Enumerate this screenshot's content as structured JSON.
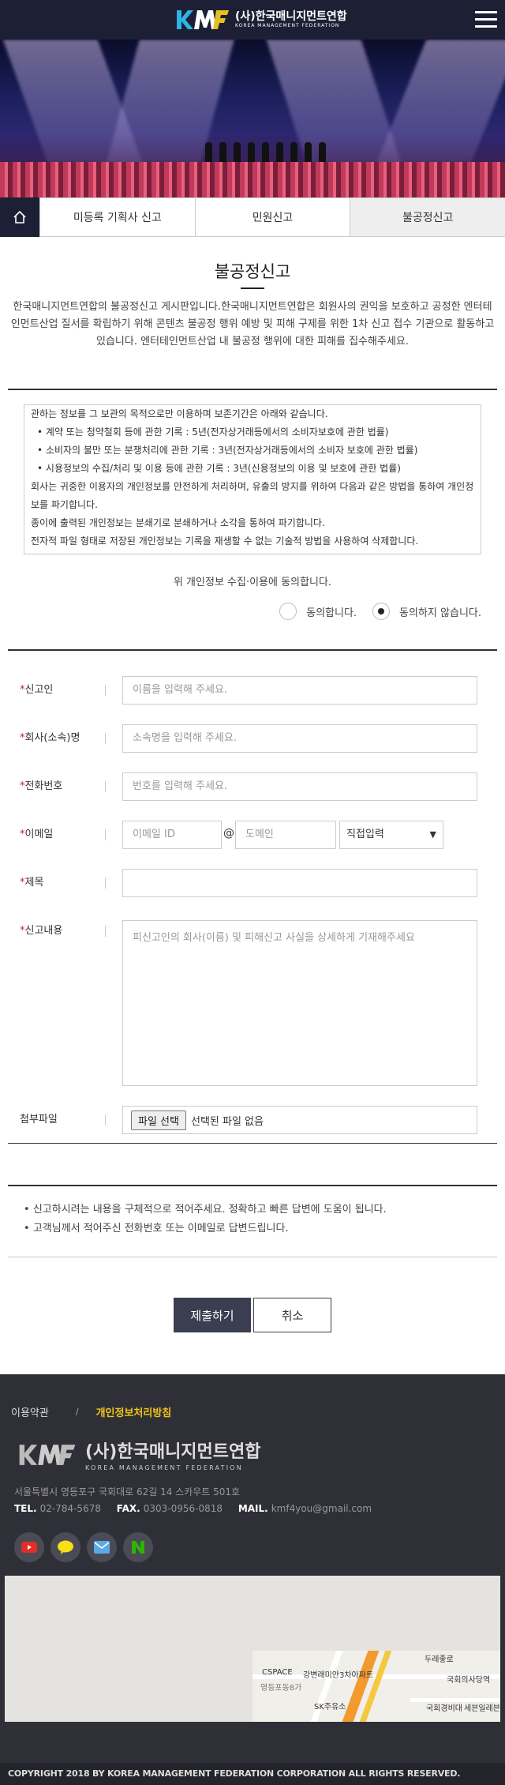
{
  "header": {
    "logo_ko": "(사)한국매니지먼트연합",
    "logo_en": "KOREA MANAGEMENT FEDERATION",
    "logo_mark": "KMF"
  },
  "tabs": [
    {
      "label": "미등록 기획사 신고",
      "active": false
    },
    {
      "label": "민원신고",
      "active": false
    },
    {
      "label": "불공정신고",
      "active": true
    }
  ],
  "page": {
    "title": "불공정신고",
    "intro": "한국매니지먼트연합의 불공정신고 게시판입니다.한국매니지먼트연합은 회원사의 권익을 보호하고 공정한 엔터테인먼트산업 질서를 확립하기 위해 콘텐츠 불공정 행위 예방 및 피해 구제를 위한 1차 신고 접수 기관으로 활동하고 있습니다. 엔터테인먼트산업 내 불공정 행위에 대한 피해를 집수해주세요."
  },
  "privacy": {
    "lines": [
      "관하는 정보를 그 보관의 목적으로만 이용하며 보존기간은 아래와 같습니다.",
      "계약 또는 청약철회 등에 관한 기록 : 5년(전자상거래등에서의 소비자보호에 관한 법률)",
      "소비자의 불만 또는 분쟁처리에 관한 기록 : 3년(전자상거래등에서의 소비자 보호에 관한 법률)",
      "시용정보의 수집/처리 및 이용 등에 관한 기록 : 3년(신용정보의 이용 및 보호에 관한 법률)",
      "회사는 귀중한 이용자의 개인정보를 안전하게 처리하며, 유출의 방지를 위하여 다음과 같은 방법을 통하여 개인정보를 파기합니다.",
      "종이에 출력된 개인정보는 분쇄기로 분쇄하거나 소각을 통하여 파기합니다.",
      "전자적 파일 형태로 저장된 개인정보는 기록을 재생할 수 없는 기술적 방법을 사용하여 삭제합니다."
    ],
    "agree_question": "위 개인정보 수집·이용에 동의합니다.",
    "agree_label": "동의합니다.",
    "disagree_label": "동의하지 않습니다.",
    "selected": "disagree"
  },
  "form": {
    "reporter": {
      "label": "신고인",
      "placeholder": "이름을 입력해 주세요."
    },
    "company": {
      "label": "회사(소속)명",
      "placeholder": "소속명을 입력해 주세요."
    },
    "phone": {
      "label": "전화번호",
      "placeholder": "번호를 입력해 주세요."
    },
    "email": {
      "label": "이메일",
      "id_placeholder": "이메일 ID",
      "at": "@",
      "domain_placeholder": "도메인",
      "select_value": "직접입력"
    },
    "subject": {
      "label": "제목",
      "value": ""
    },
    "content": {
      "label": "신고내용",
      "placeholder": "피신고인의 회사(이름) 및 피해신고 사실을 상세하게 기재해주세요"
    },
    "attach": {
      "label": "첨부파일",
      "button": "파일 선택",
      "status": "선택된 파일 없음"
    },
    "required_mark": "*"
  },
  "notes": [
    "신고하시려는 내용을 구체적으로 적어주세요. 정확하고 빠른 답변에 도움이 됩니다.",
    "고객님께서 적어주신 전화번호 또는 이메일로 답변드립니다."
  ],
  "buttons": {
    "submit": "제출하기",
    "cancel": "취소"
  },
  "footer": {
    "terms": "이용약관",
    "sep": "/",
    "privacy": "개인정보처리방침",
    "logo_ko": "(사)한국매니지먼트연합",
    "logo_en": "KOREA MANAGEMENT FEDERATION",
    "address": "서울특별시 영등포구 국회대로 62길 14 스카우트 501호",
    "tel_label": "TEL.",
    "tel": "02-784-5678",
    "fax_label": "FAX.",
    "fax": "0303-0956-0818",
    "mail_label": "MAIL.",
    "mail": "kmf4you@gmail.com",
    "sns": [
      "youtube-icon",
      "kakaotalk-icon",
      "mail-icon",
      "naver-icon"
    ],
    "map_labels": [
      "CSPACE",
      "강변래미안3차아파트",
      "SK주유소",
      "영등포동8가",
      "국회의사당역",
      "국회경비대",
      "세븐일레븐",
      "두레좋로"
    ],
    "copyright": "COPYRIGHT 2018 BY KOREA MANAGEMENT FEDERATION CORPORATION ALL RIGHTS RESERVED."
  },
  "colors": {
    "header_bg": "#1d1f35",
    "required": "#d6172d",
    "footer_bg": "#2f3037",
    "footer_highlight": "#f0c419",
    "submit_bg": "#3a3e50"
  }
}
